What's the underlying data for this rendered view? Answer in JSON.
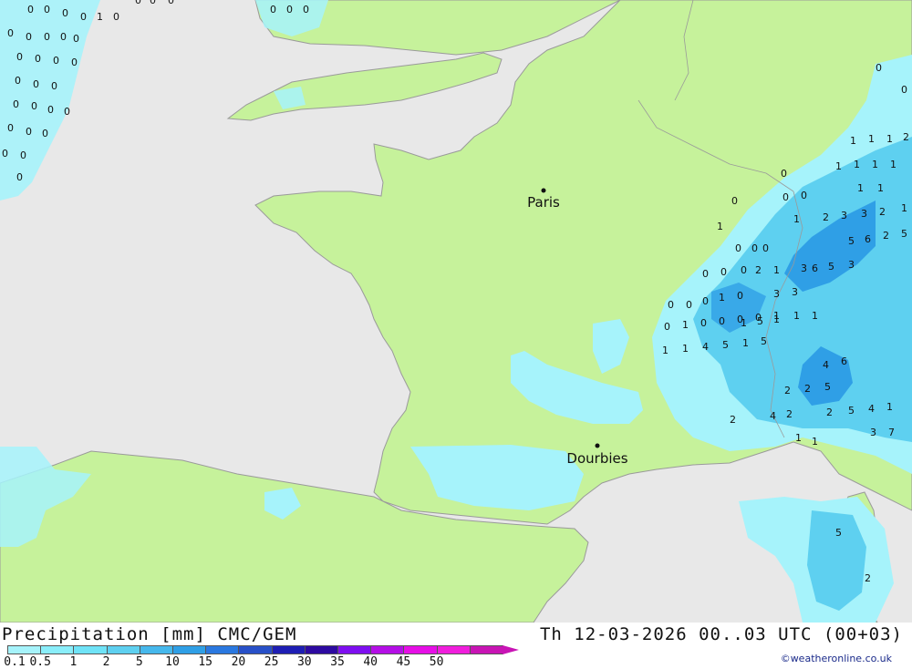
{
  "map": {
    "cities": [
      {
        "id": "paris",
        "name": "Paris"
      },
      {
        "id": "dourbies",
        "name": "Dourbies"
      }
    ],
    "values": [
      "0",
      "0",
      "0",
      "0",
      "1",
      "0",
      "0",
      "0",
      "0",
      "0",
      "0",
      "0",
      "0",
      "0",
      "0",
      "0",
      "0",
      "0",
      "0",
      "0",
      "0",
      "0",
      "0",
      "0",
      "0",
      "0",
      "0",
      "0",
      "0",
      "0",
      "0",
      "0",
      "0",
      "0",
      "0",
      "0",
      "1",
      "1",
      "1",
      "2",
      "1",
      "1",
      "1",
      "1",
      "1",
      "1",
      "1",
      "2",
      "3",
      "3",
      "2",
      "1",
      "5",
      "6",
      "2",
      "5",
      "3",
      "6",
      "5",
      "3",
      "1",
      "2",
      "3",
      "3",
      "5",
      "1",
      "1",
      "4",
      "6",
      "2",
      "2",
      "2",
      "5",
      "2",
      "4",
      "2",
      "5",
      "4",
      "7",
      "3",
      "1",
      "1",
      "1",
      "5",
      "2",
      "0",
      "1",
      "0",
      "0",
      "0",
      "0",
      "0",
      "0",
      "0",
      "0",
      "0",
      "0",
      "0",
      "0",
      "1",
      "0",
      "0",
      "1",
      "0",
      "0",
      "0",
      "0",
      "1",
      "1",
      "1",
      "1",
      "1",
      "4",
      "5",
      "1",
      "5"
    ],
    "colors": {
      "land": "#c6f29b",
      "sea": "#e8e8e8",
      "precip_light": "#a6f3fb",
      "precip_medium": "#5ed0f0",
      "precip_heavy": "#2f9fe6"
    }
  },
  "footer": {
    "title": "Precipitation [mm] CMC/GEM",
    "timestamp": "Th 12-03-2026 00..03 UTC (00+03)",
    "credit": "©weatheronline.co.uk"
  },
  "legend": {
    "labels": [
      "0.1",
      "0.5",
      "1",
      "2",
      "5",
      "10",
      "15",
      "20",
      "25",
      "30",
      "35",
      "40",
      "45",
      "50"
    ],
    "colors": [
      "#a6f3fb",
      "#8aeefa",
      "#6fe3f7",
      "#5ed0f0",
      "#46b8ec",
      "#2f9fe6",
      "#2a78e0",
      "#2850c8",
      "#1e1eb4",
      "#2d0aa0",
      "#7e0ff0",
      "#b40fe6",
      "#e60fe6",
      "#f01edc",
      "#c814b4"
    ]
  }
}
